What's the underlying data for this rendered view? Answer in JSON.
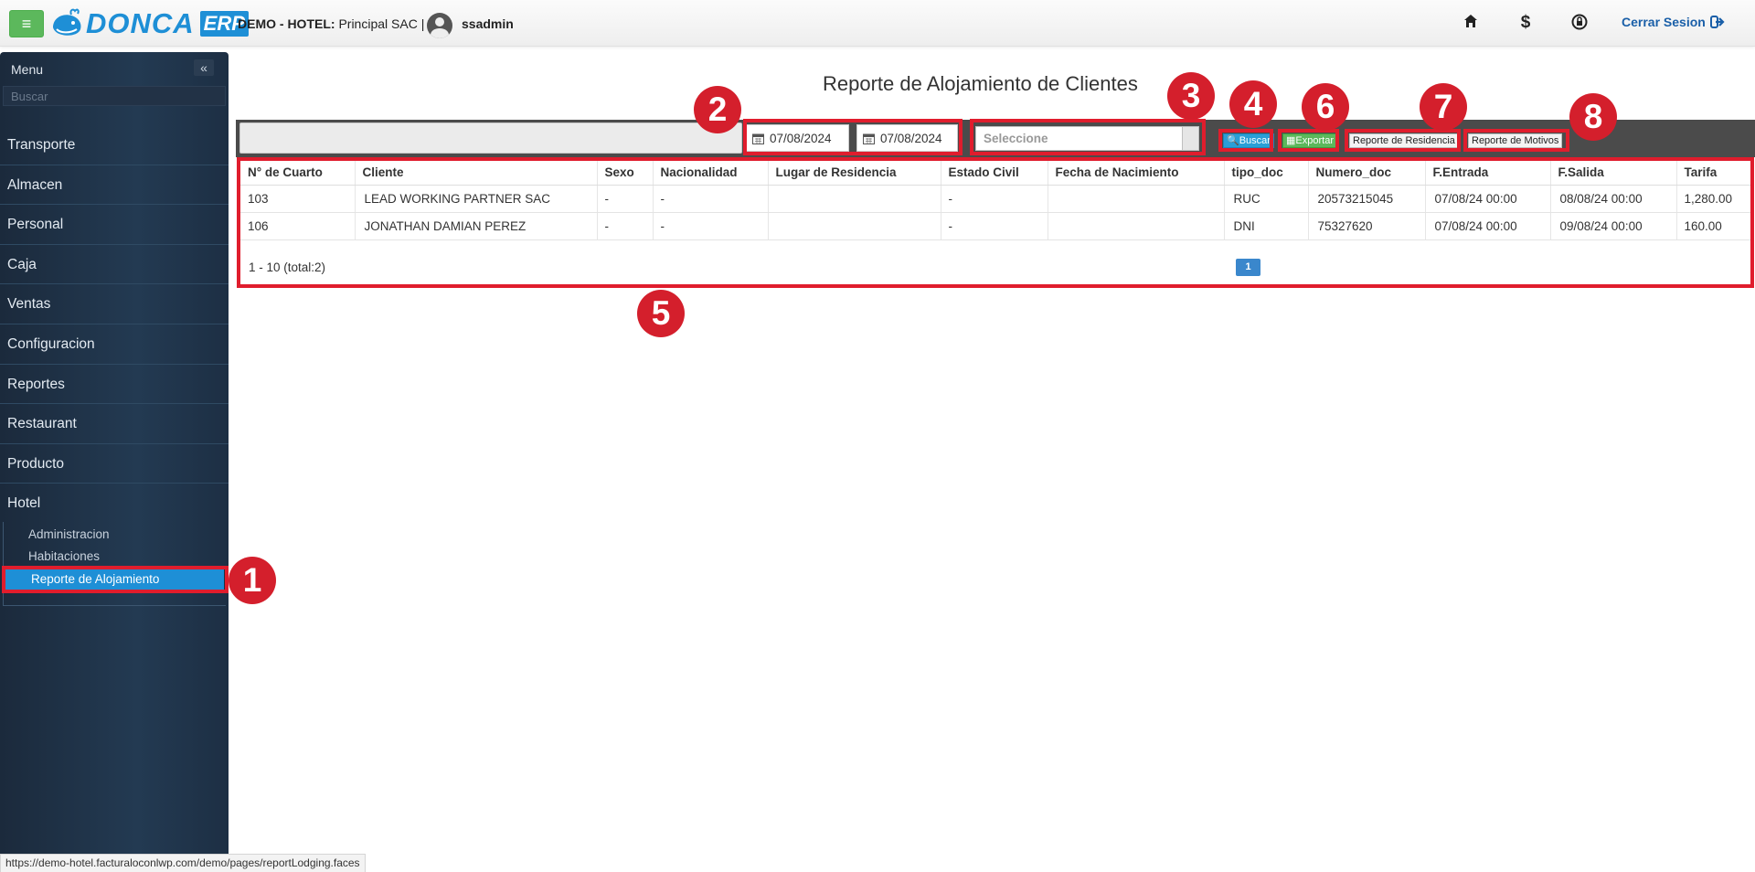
{
  "header": {
    "logo_text": "DONCA",
    "logo_badge": "ERP",
    "company_prefix": "DEMO - HOTEL:",
    "company_name": "Principal SAC |",
    "username": "ssadmin",
    "logout_label": "Cerrar Sesion",
    "icons": [
      "home-icon",
      "dollar-icon",
      "lock-refresh-icon",
      "logout-icon"
    ]
  },
  "sidebar": {
    "title": "Menu",
    "collapse_symbol": "«",
    "search_placeholder": "Buscar",
    "items": [
      "Transporte",
      "Almacen",
      "Personal",
      "Caja",
      "Ventas",
      "Configuracion",
      "Reportes",
      "Restaurant",
      "Producto",
      "Hotel"
    ],
    "sub_items": [
      "Administracion",
      "Habitaciones"
    ],
    "active_sub_item": "Reporte de Alojamiento"
  },
  "main": {
    "title": "Reporte de Alojamiento de Clientes",
    "date_from": "07/08/2024",
    "date_to": "07/08/2024",
    "select_placeholder": "Seleccione",
    "buttons": {
      "buscar": "Buscar",
      "exportar": "Exportar",
      "residencia": "Reporte de Residencia",
      "motivos": "Reporte de Motivos"
    },
    "table": {
      "columns": [
        "N° de Cuarto",
        "Cliente",
        "Sexo",
        "Nacionalidad",
        "Lugar de Residencia",
        "Estado Civil",
        "Fecha de Nacimiento",
        "tipo_doc",
        "Numero_doc",
        "F.Entrada",
        "F.Salida",
        "Tarifa"
      ],
      "rows": [
        [
          "103",
          "LEAD WORKING PARTNER SAC",
          "-",
          "-",
          "",
          "-",
          "",
          "RUC",
          "20573215045",
          "07/08/24 00:00",
          "08/08/24 00:00",
          "1,280.00"
        ],
        [
          "106",
          "JONATHAN DAMIAN PEREZ",
          "-",
          "-",
          "",
          "-",
          "",
          "DNI",
          "75327620",
          "07/08/24 00:00",
          "09/08/24 00:00",
          "160.00"
        ]
      ],
      "pagination_text": "1 - 10 (total:2)",
      "current_page": "1"
    }
  },
  "annotations": [
    "1",
    "2",
    "3",
    "4",
    "5",
    "6",
    "7",
    "8"
  ],
  "status_url": "https://demo-hotel.facturaloconlwp.com/demo/pages/reportLodging.faces",
  "colors": {
    "accent_blue": "#1e8fd6",
    "highlight_red": "#e01d2d",
    "badge_red": "#d41f2c",
    "button_green": "#5cb85c",
    "sidebar_dark": "#1b2a3c"
  }
}
